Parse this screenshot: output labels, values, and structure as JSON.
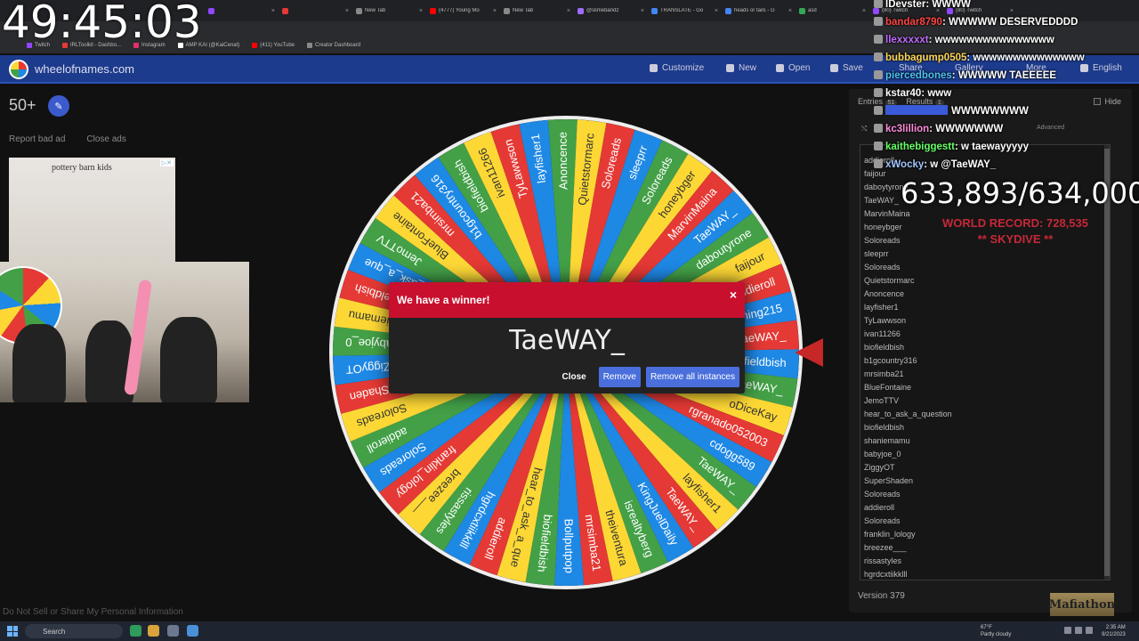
{
  "timer": "49:45:03",
  "browser": {
    "tabs": [
      {
        "label": "",
        "color": "#9146ff"
      },
      {
        "label": "",
        "color": "#e53935"
      },
      {
        "label": "New Tab",
        "color": "#888888"
      },
      {
        "label": "(4777) Young Mo",
        "color": "#ff0000"
      },
      {
        "label": "New Tab",
        "color": "#888888"
      },
      {
        "label": "@slimebandz",
        "color": "#9c6cff"
      },
      {
        "label": "TRANSLATE - Go",
        "color": "#4285f4"
      },
      {
        "label": "heads or tails - G",
        "color": "#4285f4"
      },
      {
        "label": "asd",
        "color": "#34a853"
      },
      {
        "label": "(80) Twitch",
        "color": "#9146ff"
      },
      {
        "label": "(80) Twitch",
        "color": "#9146ff"
      }
    ],
    "tab_close": "×",
    "bookmarks": [
      {
        "label": "Twitch",
        "color": "#9146ff"
      },
      {
        "label": "IRLToolkit - Dashbo...",
        "color": "#e53935"
      },
      {
        "label": "Instagram",
        "color": "#e1306c"
      },
      {
        "label": "AMP KAI (@KaiCenat)",
        "color": "#ffffff"
      },
      {
        "label": "(411) YouTube",
        "color": "#ff0000"
      },
      {
        "label": "Creator Dashboard",
        "color": "#888888"
      }
    ]
  },
  "site": {
    "name": "wheelofnames.com",
    "menu": {
      "customize": "Customize",
      "new": "New",
      "open": "Open",
      "save": "Save",
      "share": "Share",
      "gallery": "Gallery",
      "more": "More",
      "language": "English"
    }
  },
  "left": {
    "count": "50+",
    "edit_icon": "✎",
    "report_ad": "Report bad ad",
    "close_ads": "Close ads",
    "ad_title": "pottery barn kids",
    "ad_tag": "▷✕",
    "footer": "Do Not Sell or Share My Personal Information"
  },
  "wheel": {
    "colors": [
      "#e53935",
      "#1e88e5",
      "#43a047",
      "#fdd835"
    ],
    "labels": [
      "TaeWAY_",
      "biofieldbish",
      "TaeWAY_",
      "oDiceKay",
      "rgranado052003",
      "cdogg589",
      "TaeWAY_",
      "layfisher1",
      "TaeWAY_",
      "KingJuelDaily",
      "isrealtyberg",
      "theiventura",
      "mrsimba21",
      "Bollputpop",
      "biofieldbish",
      "hear_to_ask_a_que",
      "addieroll",
      "hgrdcxtiikklll",
      "rissastyles",
      "breezee___",
      "franklin_lology",
      "Soloreads",
      "addieroll",
      "Soloreads",
      "SuperShaden",
      "ZiggyOT",
      "babyjoe_0",
      "shaniemamu",
      "biofieldbish",
      "hear_to_ask_a_que",
      "JemoTTV",
      "BlueFontaine",
      "mrsimba21",
      "b1gcountry316",
      "biofieldbish",
      "ivan11266",
      "TyLawwson",
      "layfisher1",
      "Anoncence",
      "Quietstormarc",
      "Soloreads",
      "sleeprr",
      "Soloreads",
      "honeybger",
      "MarvinMaina",
      "TaeWAY_",
      "daboutyrone",
      "faijour",
      "addieroll",
      "Gaming215"
    ]
  },
  "modal": {
    "title": "We have a winner!",
    "close_x": "×",
    "winner": "TaeWAY_",
    "close": "Close",
    "remove": "Remove",
    "remove_all": "Remove all instances"
  },
  "panel": {
    "tab_entries": "Entries",
    "entries_count": "51",
    "tab_results": "Results",
    "results_count": "1",
    "hide": "Hide",
    "shuffle": "⤭",
    "advanced": "Advanced",
    "entries": [
      "addieroll",
      "faijour",
      "daboytyrone",
      "TaeWAY_",
      "MarvinMaina",
      "honeybger",
      "Soloreads",
      "sleeprr",
      "Soloreads",
      "Quietstormarc",
      "Anoncence",
      "layfisher1",
      "TyLawwson",
      "ivan11266",
      "biofieldbish",
      "b1gcountry316",
      "mrsimba21",
      "BlueFontaine",
      "JemoTTV",
      "hear_to_ask_a_question",
      "biofieldbish",
      "shaniemamu",
      "babyjoe_0",
      "ZiggyOT",
      "SuperShaden",
      "Soloreads",
      "addieroll",
      "Soloreads",
      "franklin_lology",
      "breezee___",
      "rissastyles",
      "hgrdcxtiikklll"
    ],
    "version": "Version 379"
  },
  "chat": [
    {
      "user": "lDevster",
      "color": "#ffffff",
      "text": "WWWW"
    },
    {
      "user": "bandar8790",
      "color": "#ff4444",
      "text": "WWWWW DESERVEDDDD"
    },
    {
      "user": "llexxxxxt",
      "color": "#c06cff",
      "text": "wwwwwwwwwwwwwww"
    },
    {
      "user": "bubbagump0505",
      "color": "#ffd54f",
      "text": "wwwwwwwwwwwwww"
    },
    {
      "user": "piercedbones",
      "color": "#4fc3f7",
      "text": "WWWWW TAEEEEE"
    },
    {
      "user": "kstar40",
      "color": "#ffffff",
      "text": "www"
    },
    {
      "user": "",
      "color": "#3a5bd9",
      "text": "WWWWWWWW"
    },
    {
      "user": "kc3lillion",
      "color": "#ff8cdc",
      "text": "WWWWWWW"
    },
    {
      "user": "kaithebiggestt",
      "color": "#66ff66",
      "text": "w taewayyyyy"
    },
    {
      "user": "xWocky",
      "color": "#a0c4ff",
      "text": "w @TaeWAY_"
    }
  ],
  "overlay": {
    "goal": "633,893/634,000",
    "record": "WORLD RECORD: 728,535",
    "record_sub": "** SKYDIVE **",
    "logo": "Mafiathon"
  },
  "taskbar": {
    "search": "Search",
    "weather_temp": "67°F",
    "weather_desc": "Partly cloudy",
    "time": "2:35 AM",
    "date": "9/21/2023"
  }
}
